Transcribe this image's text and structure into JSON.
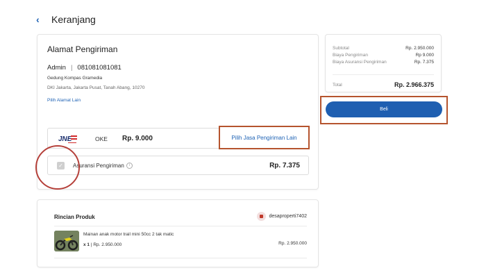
{
  "header": {
    "back_icon": "chevron-left-icon",
    "title": "Keranjang"
  },
  "address": {
    "title": "Alamat Pengiriman",
    "name": "Admin",
    "phone": "081081081081",
    "line1": "Gedung Kompas Gramedia",
    "line2": "DKI Jakarta, Jakarta Pusat, Tanah Abang, 10270",
    "change_link": "Pilih Alamat Lain"
  },
  "shipping": {
    "logo_icon": "jne-logo",
    "service": "OKE",
    "price": "Rp. 9.000",
    "change_label": "Pilih Jasa Pengiriman Lain"
  },
  "insurance": {
    "label": "Asuransi Pengiriman",
    "price": "Rp. 7.375",
    "checked": true
  },
  "product": {
    "section_title": "Rincian Produk",
    "seller": "desaproperti7402",
    "name": "Mainan anak motor trail mini 50cc 2 tak matic",
    "qty": "x 1",
    "unit_price": "Rp. 2.950.000",
    "total_price": "Rp. 2.950.000"
  },
  "summary": {
    "rows": [
      {
        "label": "Subtotal",
        "value": "Rp. 2.950.000"
      },
      {
        "label": "Biaya Pengiriman",
        "value": "Rp 9.000"
      },
      {
        "label": "Biaya Asuransi Pengiriman",
        "value": "Rp. 7.375"
      }
    ],
    "total_label": "Total",
    "total_value": "Rp. 2.966.375",
    "buy_label": "Beli"
  },
  "colors": {
    "accent": "#1f5fb1",
    "highlight": "#b5542e"
  }
}
